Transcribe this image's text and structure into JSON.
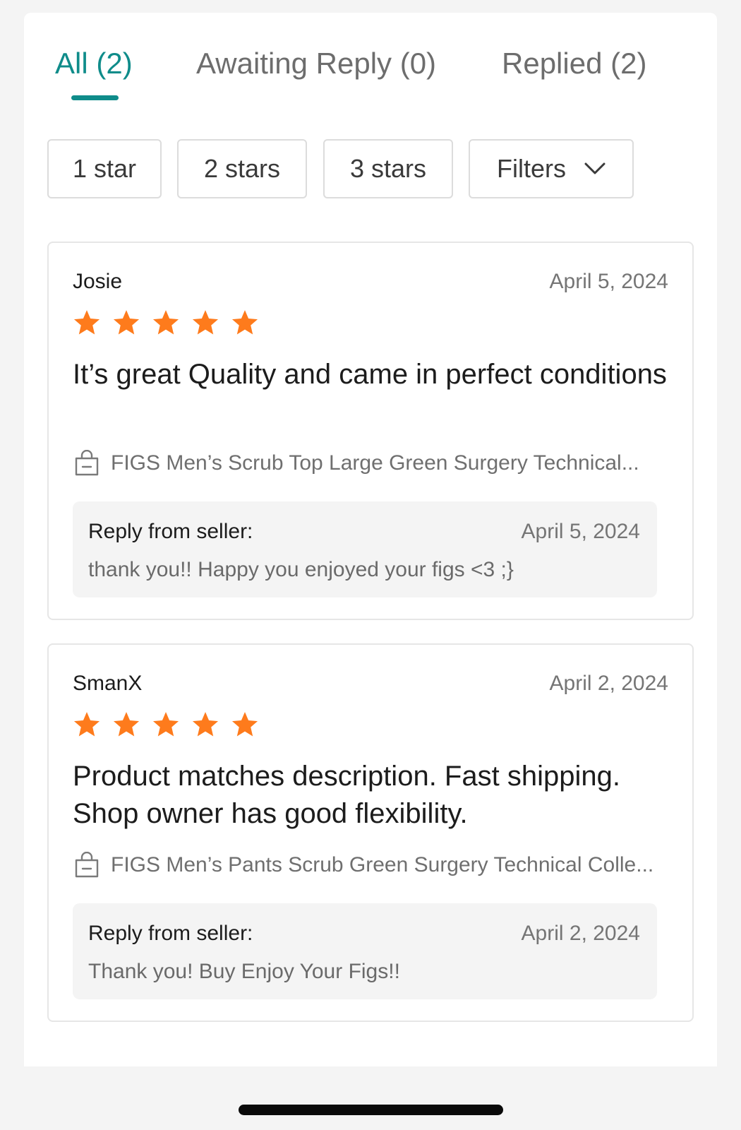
{
  "tabs": [
    {
      "label": "All (2)"
    },
    {
      "label": "Awaiting Reply (0)"
    },
    {
      "label": "Replied (2)"
    }
  ],
  "filters": {
    "chips": [
      {
        "label": "1 star"
      },
      {
        "label": "2 stars"
      },
      {
        "label": "3 stars"
      }
    ],
    "filters_label": "Filters",
    "filters_icon": "chevron-down-icon"
  },
  "colors": {
    "accent": "#0f8c8a",
    "star": "#fe7b1c"
  },
  "reviews": [
    {
      "reviewer": "Josie",
      "date": "April 5, 2024",
      "rating": 5,
      "max_rating": 5,
      "text": "It’s great Quality and came in perfect conditions",
      "product": "FIGS Men’s Scrub Top Large Green Surgery Technical...",
      "product_icon": "shopping-bag-icon",
      "reply": {
        "label": "Reply from seller:",
        "date": "April 5, 2024",
        "text": "thank you!! Happy you enjoyed your figs <3 ;}"
      }
    },
    {
      "reviewer": "SmanX",
      "date": "April 2, 2024",
      "rating": 5,
      "max_rating": 5,
      "text": "Product matches description. Fast shipping. Shop owner has good flexibility.",
      "product": "FIGS Men’s Pants Scrub Green Surgery Technical Colle...",
      "product_icon": "shopping-bag-icon",
      "reply": {
        "label": "Reply from seller:",
        "date": "April 2, 2024",
        "text": "Thank you! Buy Enjoy Your Figs!!"
      }
    }
  ]
}
